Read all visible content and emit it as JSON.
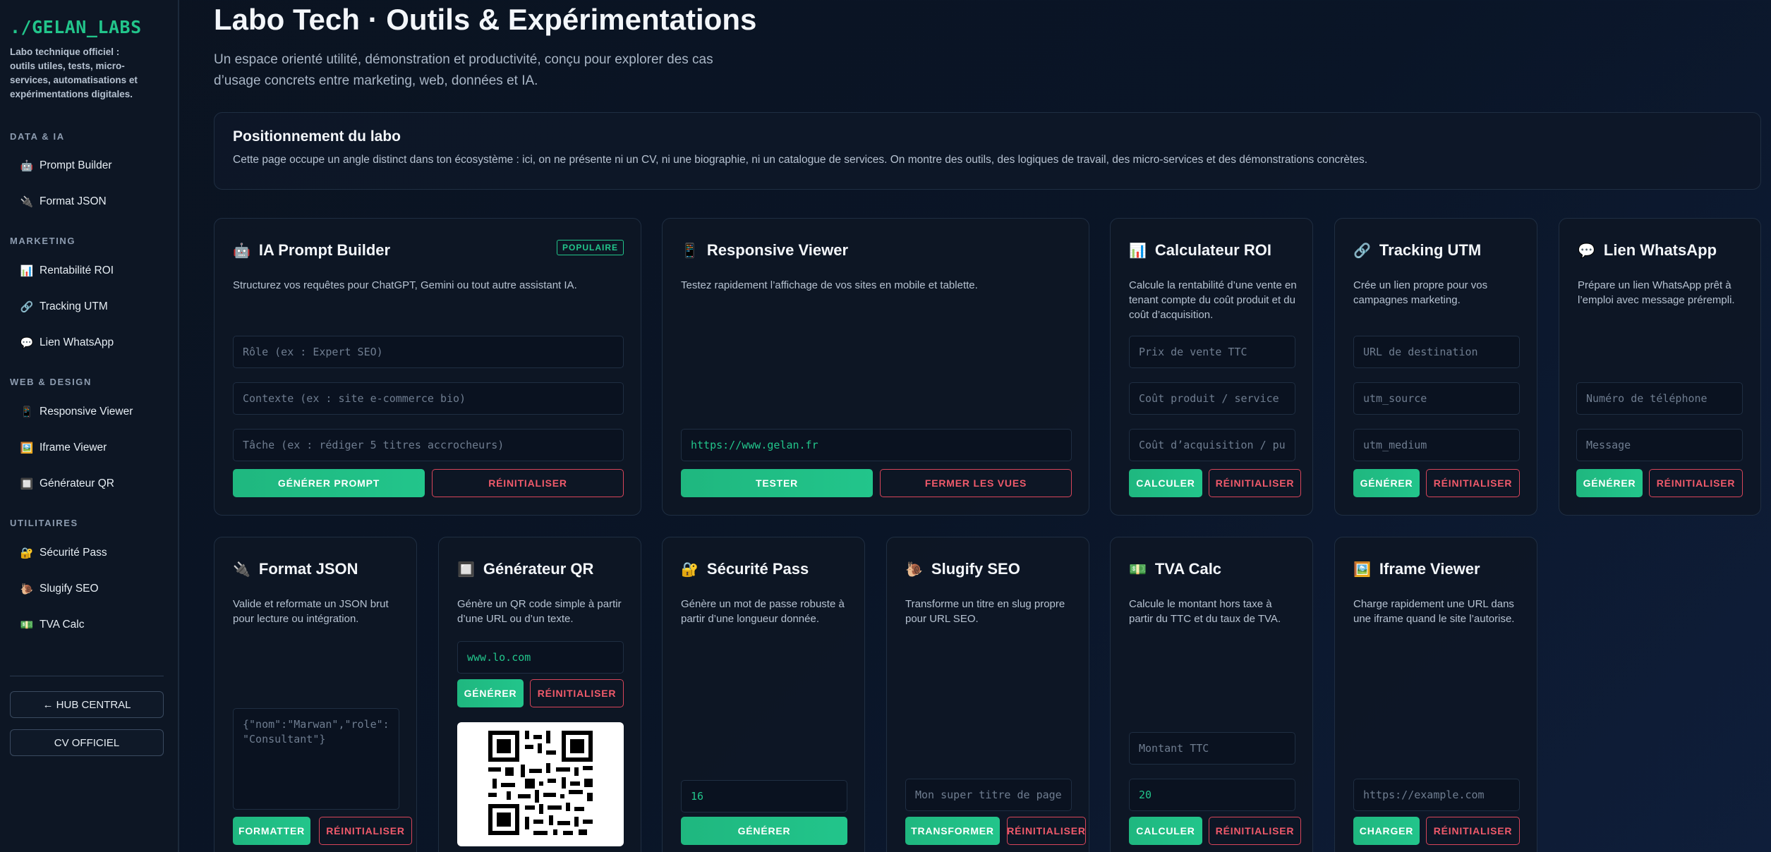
{
  "sidebar": {
    "logo": "./GELAN_LABS",
    "tagline": "Labo technique officiel : outils utiles, tests, micro-services, automatisations et expérimentations digitales.",
    "sections": [
      {
        "title": "DATA & IA",
        "items": [
          {
            "icon": "🤖",
            "label": "Prompt Builder"
          },
          {
            "icon": "🔌",
            "label": "Format JSON"
          }
        ]
      },
      {
        "title": "MARKETING",
        "items": [
          {
            "icon": "📊",
            "label": "Rentabilité ROI"
          },
          {
            "icon": "🔗",
            "label": "Tracking UTM"
          },
          {
            "icon": "💬",
            "label": "Lien WhatsApp"
          }
        ]
      },
      {
        "title": "WEB & DESIGN",
        "items": [
          {
            "icon": "📱",
            "label": "Responsive Viewer"
          },
          {
            "icon": "🖼️",
            "label": "Iframe Viewer"
          },
          {
            "icon": "🔲",
            "label": "Générateur QR"
          }
        ]
      },
      {
        "title": "UTILITAIRES",
        "items": [
          {
            "icon": "🔐",
            "label": "Sécurité Pass"
          },
          {
            "icon": "🐌",
            "label": "Slugify SEO"
          },
          {
            "icon": "💵",
            "label": "TVA Calc"
          }
        ]
      }
    ],
    "hub_button": "← HUB CENTRAL",
    "cv_button": "CV OFFICIEL"
  },
  "header": {
    "title": "Labo Tech · Outils & Expérimentations",
    "subtitle": "Un espace orienté utilité, démonstration et productivité, conçu pour explorer des cas d’usage concrets entre marketing, web, données et IA."
  },
  "positioning": {
    "title": "Positionnement du labo",
    "text": "Cette page occupe un angle distinct dans ton écosystème : ici, on ne présente ni un CV, ni une biographie, ni un catalogue de services. On montre des outils, des logiques de travail, des micro-services et des démonstrations concrètes."
  },
  "cards": {
    "prompt": {
      "icon": "🤖",
      "title": "IA Prompt Builder",
      "badge": "POPULAIRE",
      "desc": "Structurez vos requêtes pour ChatGPT, Gemini ou tout autre assistant IA.",
      "ph_role": "Rôle (ex : Expert SEO)",
      "ph_context": "Contexte (ex : site e-commerce bio)",
      "ph_task": "Tâche (ex : rédiger 5 titres accrocheurs)",
      "btn_primary": "GÉNÉRER PROMPT",
      "btn_reset": "RÉINITIALISER"
    },
    "responsive": {
      "icon": "📱",
      "title": "Responsive Viewer",
      "desc": "Testez rapidement l’affichage de vos sites en mobile et tablette.",
      "url_value": "https://www.gelan.fr",
      "btn_primary": "TESTER",
      "btn_reset": "FERMER LES VUES"
    },
    "roi": {
      "icon": "📊",
      "title": "Calculateur ROI",
      "desc": "Calcule la rentabilité d’une vente en tenant compte du coût produit et du coût d’acquisition.",
      "ph_price": "Prix de vente TTC",
      "ph_cost": "Coût produit / service",
      "ph_acq": "Coût d’acquisition / pub",
      "btn_primary": "CALCULER",
      "btn_reset": "RÉINITIALISER"
    },
    "utm": {
      "icon": "🔗",
      "title": "Tracking UTM",
      "desc": "Crée un lien propre pour vos campagnes marketing.",
      "ph_url": "URL de destination",
      "ph_source": "utm_source",
      "ph_medium": "utm_medium",
      "btn_primary": "GÉNÉRER",
      "btn_reset": "RÉINITIALISER"
    },
    "whatsapp": {
      "icon": "💬",
      "title": "Lien WhatsApp",
      "desc": "Prépare un lien WhatsApp prêt à l’emploi avec message prérempli.",
      "ph_phone": "Numéro de téléphone",
      "ph_message": "Message",
      "btn_primary": "GÉNÉRER",
      "btn_reset": "RÉINITIALISER"
    },
    "json": {
      "icon": "🔌",
      "title": "Format JSON",
      "desc": "Valide et reformate un JSON brut pour lecture ou intégration.",
      "ph_json": "{\"nom\":\"Marwan\",\"role\":\"Consultant\"}",
      "btn_primary": "FORMATTER",
      "btn_reset": "RÉINITIALISER"
    },
    "qr": {
      "icon": "🔲",
      "title": "Générateur QR",
      "desc": "Génère un QR code simple à partir d’une URL ou d’un texte.",
      "value": "www.lo.com",
      "btn_primary": "GÉNÉRER",
      "btn_reset": "RÉINITIALISER"
    },
    "pass": {
      "icon": "🔐",
      "title": "Sécurité Pass",
      "desc": "Génère un mot de passe robuste à partir d’une longueur donnée.",
      "length_value": "16",
      "btn_primary": "GÉNÉRER"
    },
    "slug": {
      "icon": "🐌",
      "title": "Slugify SEO",
      "desc": "Transforme un titre en slug propre pour URL SEO.",
      "ph_title": "Mon super titre de page",
      "btn_primary": "TRANSFORMER",
      "btn_reset": "RÉINITIALISER"
    },
    "tva": {
      "icon": "💵",
      "title": "TVA Calc",
      "desc": "Calcule le montant hors taxe à partir du TTC et du taux de TVA.",
      "ph_amount": "Montant TTC",
      "rate_value": "20",
      "btn_primary": "CALCULER",
      "btn_reset": "RÉINITIALISER"
    },
    "iframe": {
      "icon": "🖼️",
      "title": "Iframe Viewer",
      "desc": "Charge rapidement une URL dans une iframe quand le site l’autorise.",
      "ph_url": "https://example.com",
      "btn_primary": "CHARGER",
      "btn_reset": "RÉINITIALISER"
    }
  },
  "colors": {
    "accent": "#22c58b",
    "danger": "#f05a6b",
    "background": "#0b1320"
  }
}
